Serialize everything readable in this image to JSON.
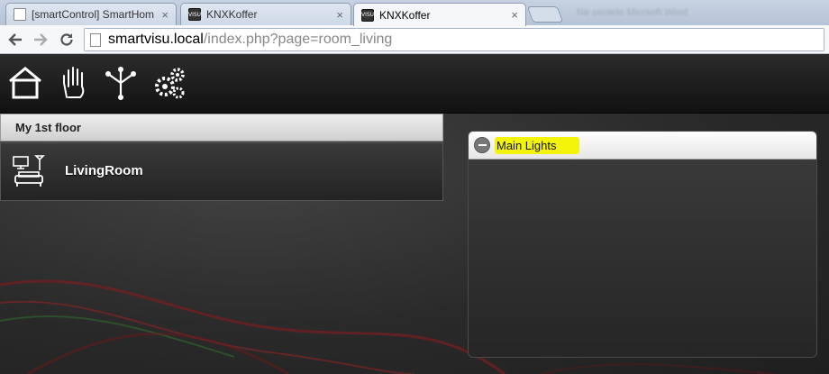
{
  "browser": {
    "tabs": [
      {
        "title": "[smartControl] SmartHom",
        "favicon": "page-icon",
        "active": false
      },
      {
        "title": "KNXKoffer",
        "favicon": "visu-icon",
        "active": false
      },
      {
        "title": "KNXKoffer",
        "favicon": "visu-icon",
        "active": true
      }
    ],
    "close_glyph": "×",
    "blurred_title": "Ne sentele Micrsoft Word",
    "favicon_text": "VISU",
    "url_host": "smartvisu.local",
    "url_path": "/index.php?page=room_living"
  },
  "nav": {
    "icons": [
      "home-icon",
      "hand-icon",
      "network-icon",
      "gears-icon"
    ]
  },
  "sidebar": {
    "header": "My 1st floor",
    "items": [
      {
        "label": "LivingRoom",
        "icon": "living-room-icon"
      }
    ]
  },
  "widget": {
    "title": "Main Lights",
    "highlight_color": "#f4f40a"
  }
}
